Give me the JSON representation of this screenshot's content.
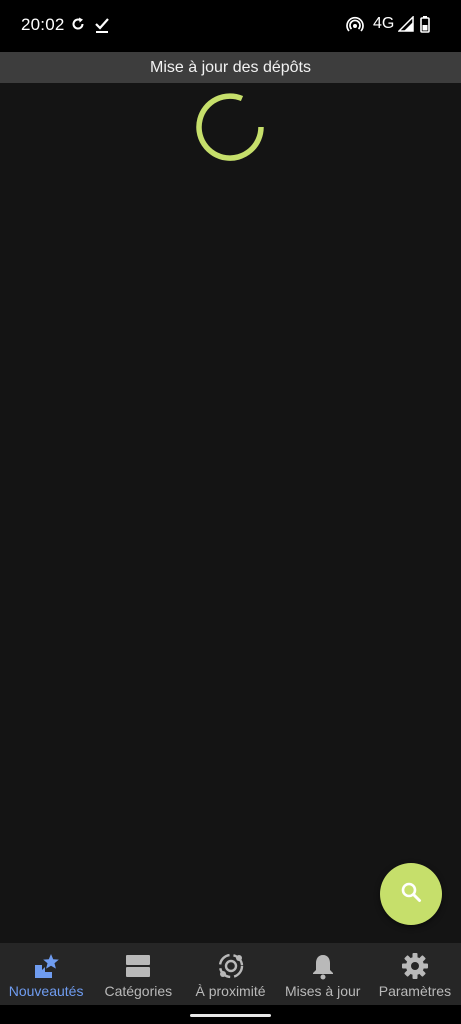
{
  "status_bar": {
    "time": "20:02",
    "network": "4G",
    "icons": [
      "sync-icon",
      "check-icon",
      "hotspot-icon",
      "signal-icon",
      "battery-icon"
    ]
  },
  "banner": {
    "text": "Mise à jour des dépôts"
  },
  "content": {
    "loading": true,
    "accent_color": "#c6df6b"
  },
  "fab": {
    "icon": "search-icon"
  },
  "bottom_nav": {
    "items": [
      {
        "label": "Nouveautés",
        "icon": "new-star-icon",
        "active": true
      },
      {
        "label": "Catégories",
        "icon": "categories-icon",
        "active": false
      },
      {
        "label": "À proximité",
        "icon": "nearby-icon",
        "active": false
      },
      {
        "label": "Mises à jour",
        "icon": "bell-icon",
        "active": false
      },
      {
        "label": "Paramètres",
        "icon": "gear-icon",
        "active": false
      }
    ],
    "active_color": "#6f9cf0",
    "inactive_color": "#b9b9b9"
  }
}
